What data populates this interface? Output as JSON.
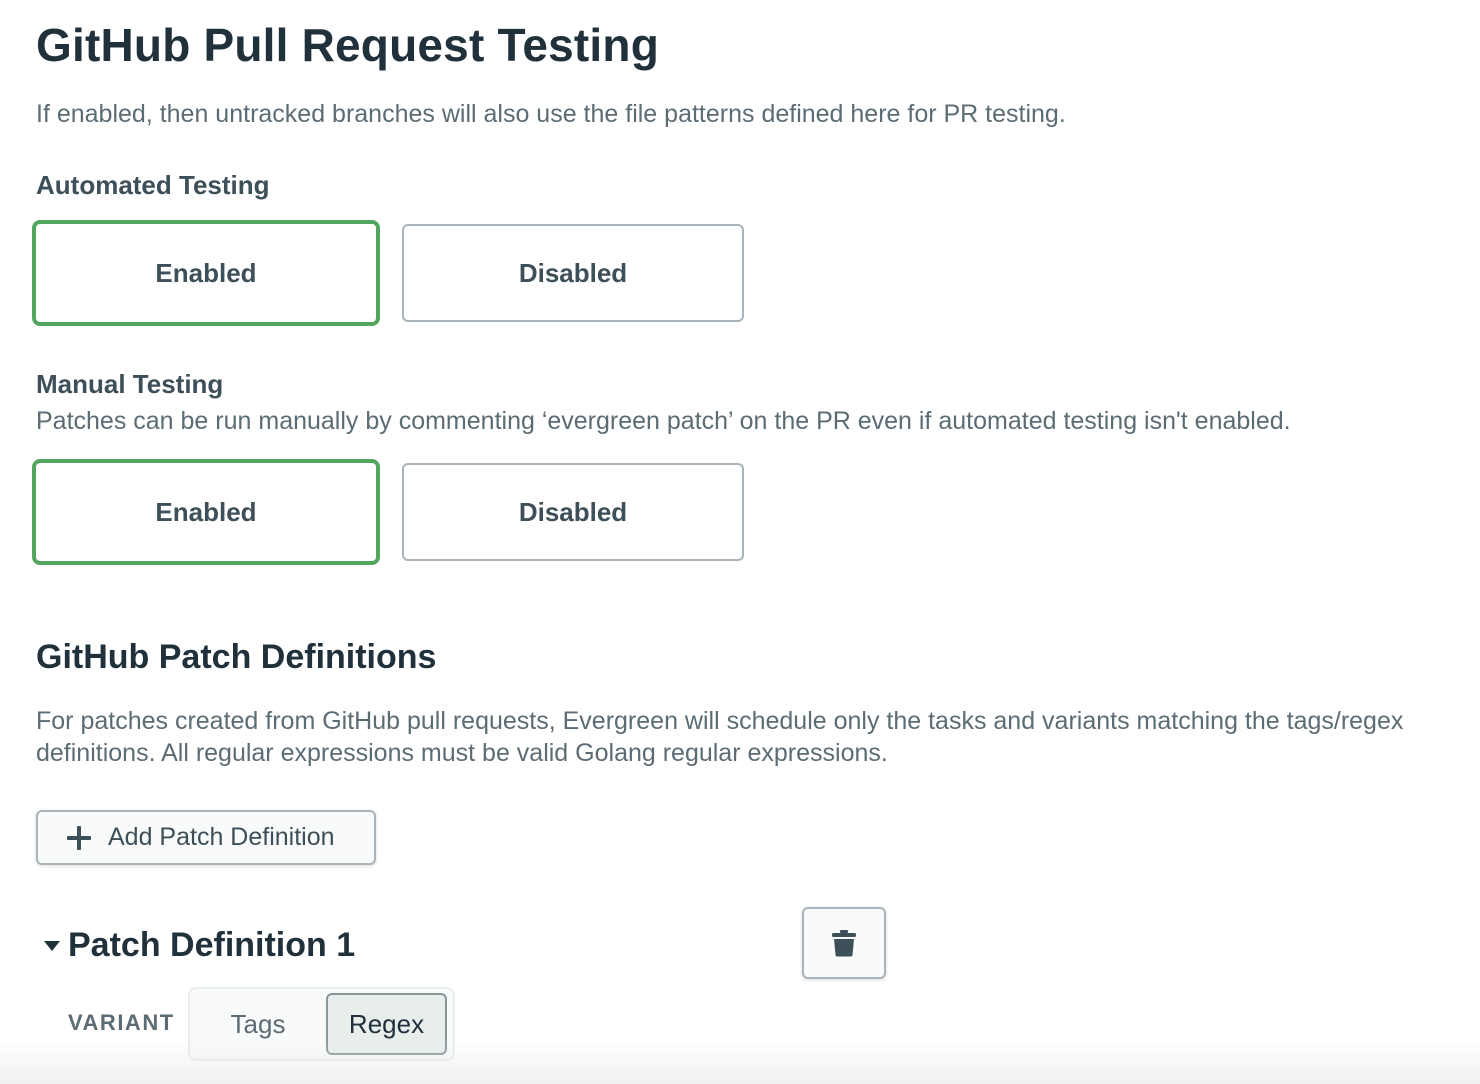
{
  "header": {
    "title": "GitHub Pull Request Testing",
    "description": "If enabled, then untracked branches will also use the file patterns defined here for PR testing."
  },
  "automated_testing": {
    "label": "Automated Testing",
    "options": [
      "Enabled",
      "Disabled"
    ],
    "selected": "Enabled"
  },
  "manual_testing": {
    "label": "Manual Testing",
    "description": "Patches can be run manually by commenting ‘evergreen patch’ on the PR even if automated testing isn't enabled.",
    "options": [
      "Enabled",
      "Disabled"
    ],
    "selected": "Enabled"
  },
  "patch_definitions": {
    "title": "GitHub Patch Definitions",
    "description": "For patches created from GitHub pull requests, Evergreen will schedule only the tasks and variants matching the tags/regex definitions. All regular expressions must be valid Golang regular expressions.",
    "add_button_label": "Add Patch Definition",
    "items": [
      {
        "title": "Patch Definition 1",
        "variant_label": "VARIANT",
        "variant_options": [
          "Tags",
          "Regex"
        ],
        "variant_selected": "Regex"
      }
    ]
  },
  "colors": {
    "selected_border": "#53a660",
    "unselected_border": "#a9b4ba",
    "heading": "#21313c",
    "body_text": "#5c6c75"
  },
  "icons": {
    "add": "plus-icon",
    "delete": "trash-icon",
    "collapse": "caret-down-icon"
  }
}
